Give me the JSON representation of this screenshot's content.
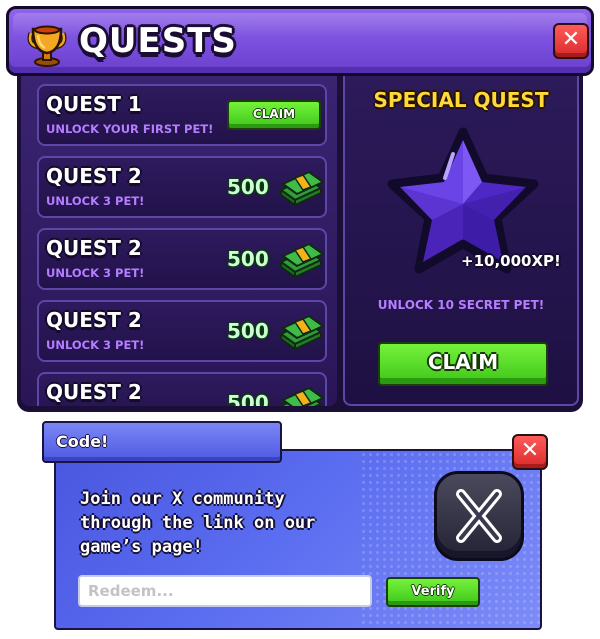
{
  "header": {
    "title": "QUESTS",
    "icon": "trophy-icon",
    "close_label": "✕"
  },
  "quests": [
    {
      "title": "QUEST 1",
      "description": "UNLOCK YOUR FIRST PET!",
      "action": "CLAIM"
    },
    {
      "title": "QUEST 2",
      "description": "UNLOCK 3 PET!",
      "reward": "500",
      "reward_icon": "cash-icon"
    },
    {
      "title": "QUEST 2",
      "description": "UNLOCK 3 PET!",
      "reward": "500",
      "reward_icon": "cash-icon"
    },
    {
      "title": "QUEST 2",
      "description": "UNLOCK 3 PET!",
      "reward": "500",
      "reward_icon": "cash-icon"
    },
    {
      "title": "QUEST 2",
      "description": "",
      "reward": "500",
      "reward_icon": "cash-icon"
    }
  ],
  "special_quest": {
    "title": "SPECIAL QUEST",
    "icon": "star-icon",
    "xp": "+10,000XP!",
    "description": "UNLOCK 10 SECRET PET!",
    "action": "CLAIM"
  },
  "code_dialog": {
    "tab_label": "Code!",
    "close_label": "✕",
    "message_lines": [
      "Join our X community",
      "through the link on our",
      "game’s page!"
    ],
    "logo_icon": "x-logo-icon",
    "input_placeholder": "Redeem...",
    "input_value": "",
    "verify_label": "Verify"
  },
  "colors": {
    "header_purple": "#7a4fdd",
    "panel_dark": "#1b0f38",
    "accent_green": "#4fd424",
    "special_yellow": "#ffd83a",
    "subtext_purple": "#b47eff",
    "close_red": "#e83636",
    "dialog_blue": "#5a6cf0"
  }
}
